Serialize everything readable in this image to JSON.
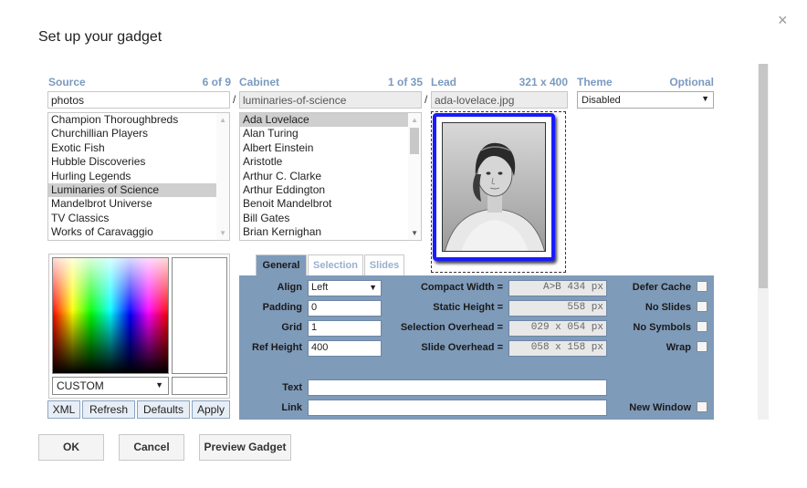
{
  "dialog": {
    "title": "Set up your gadget",
    "close": "×"
  },
  "source": {
    "label": "Source",
    "count": "6 of 9",
    "value": "photos",
    "items": [
      "Champion Thoroughbreds",
      "Churchillian Players",
      "Exotic Fish",
      "Hubble Discoveries",
      "Hurling Legends",
      "Luminaries of Science",
      "Mandelbrot Universe",
      "TV Classics",
      "Works of Caravaggio"
    ],
    "selected_index": 5
  },
  "cabinet": {
    "label": "Cabinet",
    "count": "1 of 35",
    "value": "luminaries-of-science",
    "items": [
      "Ada Lovelace",
      "Alan Turing",
      "Albert Einstein",
      "Aristotle",
      "Arthur C. Clarke",
      "Arthur Eddington",
      "Benoit Mandelbrot",
      "Bill Gates",
      "Brian Kernighan"
    ],
    "selected_index": 0
  },
  "lead": {
    "label": "Lead",
    "count": "321 x 400",
    "value": "ada-lovelace.jpg"
  },
  "theme": {
    "label": "Theme",
    "optional": "Optional",
    "value": "Disabled"
  },
  "separator": "/",
  "color": {
    "mode": "CUSTOM"
  },
  "small_buttons": {
    "xml": "XML",
    "refresh": "Refresh",
    "defaults": "Defaults",
    "apply": "Apply"
  },
  "tabs": {
    "general": "General",
    "selection": "Selection",
    "slides": "Slides"
  },
  "general": {
    "align_label": "Align",
    "align_value": "Left",
    "padding_label": "Padding",
    "padding_value": "0",
    "grid_label": "Grid",
    "grid_value": "1",
    "ref_height_label": "Ref Height",
    "ref_height_value": "400",
    "compact_width_label": "Compact Width =",
    "compact_width_value": "A>B   434  px",
    "static_height_label": "Static Height =",
    "static_height_value": "558  px",
    "selection_overhead_label": "Selection Overhead =",
    "selection_overhead_value": "029 x 054  px",
    "slide_overhead_label": "Slide Overhead =",
    "slide_overhead_value": "058 x 158  px",
    "defer_cache_label": "Defer Cache",
    "no_slides_label": "No Slides",
    "no_symbols_label": "No Symbols",
    "wrap_label": "Wrap",
    "text_label": "Text",
    "text_value": "",
    "link_label": "Link",
    "link_value": "",
    "new_window_label": "New Window"
  },
  "footer": {
    "ok": "OK",
    "cancel": "Cancel",
    "preview": "Preview Gadget"
  },
  "colors": {
    "accent": "#7f9bba",
    "header_blue": "#7a9ac0",
    "selection_border": "#1a1aff"
  }
}
